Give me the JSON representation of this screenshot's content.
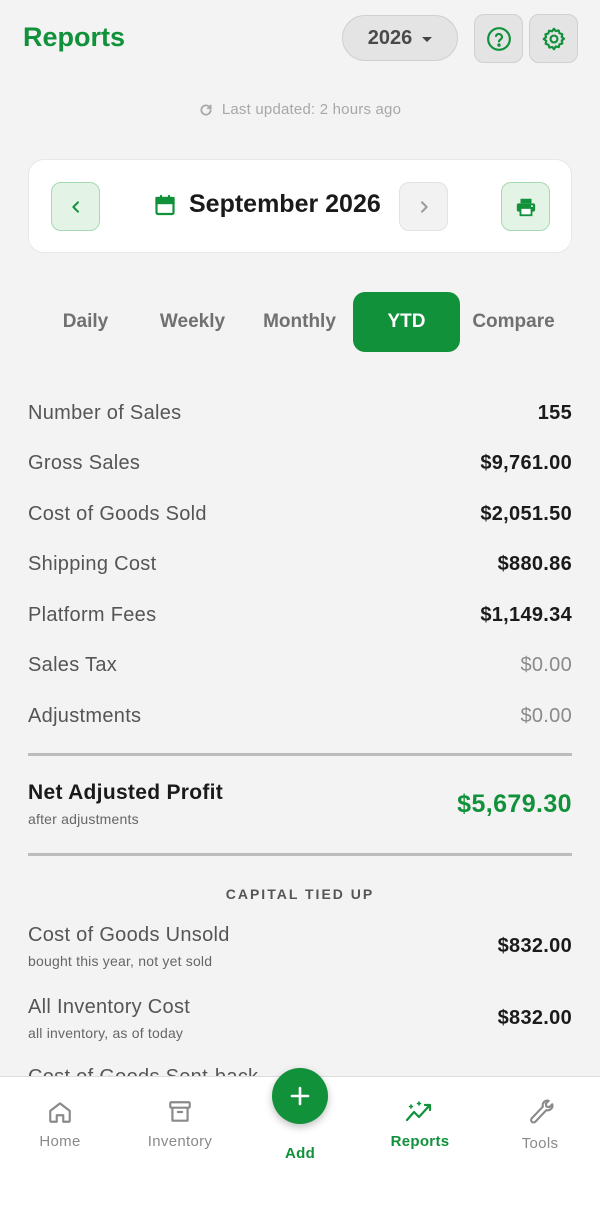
{
  "header": {
    "title": "Reports",
    "year": "2026",
    "help_icon": "help-circle-icon",
    "settings_icon": "gear-icon"
  },
  "last_updated": "Last updated: 2 hours ago",
  "month_nav": {
    "month": "September 2026",
    "prev_icon": "chevron-left-icon",
    "next_icon": "chevron-right-icon",
    "print_icon": "printer-icon",
    "calendar_icon": "calendar-icon"
  },
  "tabs": [
    {
      "label": "Daily",
      "active": false
    },
    {
      "label": "Weekly",
      "active": false
    },
    {
      "label": "Monthly",
      "active": false
    },
    {
      "label": "YTD",
      "active": true
    },
    {
      "label": "Compare",
      "active": false
    }
  ],
  "summary": [
    {
      "label": "Number of Sales",
      "value": "155"
    },
    {
      "label": "Gross Sales",
      "value": "$9,761.00"
    },
    {
      "label": "Cost of Goods Sold",
      "value": "$2,051.50"
    },
    {
      "label": "Shipping Cost",
      "value": "$880.86"
    },
    {
      "label": "Platform Fees",
      "value": "$1,149.34"
    },
    {
      "label": "Sales Tax",
      "value": "$0.00"
    },
    {
      "label": "Adjustments",
      "value": "$0.00"
    }
  ],
  "net_profit": {
    "label": "Net Adjusted Profit",
    "sublabel": "after adjustments",
    "value": "$5,679.30"
  },
  "capital": {
    "title": "CAPITAL TIED UP",
    "items": [
      {
        "label": "Cost of Goods Unsold",
        "sublabel": "bought this year, not yet sold",
        "value": "$832.00"
      },
      {
        "label": "All Inventory Cost",
        "sublabel": "all inventory, as of today",
        "value": "$832.00"
      }
    ],
    "partial_label": "Cost of Goods Sent-back"
  },
  "bottom_nav": [
    {
      "label": "Home",
      "icon": "home-icon",
      "active": false
    },
    {
      "label": "Inventory",
      "icon": "archive-icon",
      "active": false
    },
    {
      "label": "Add",
      "icon": "plus-icon",
      "active": false
    },
    {
      "label": "Reports",
      "icon": "trend-chart-icon",
      "active": true
    },
    {
      "label": "Tools",
      "icon": "wrench-icon",
      "active": false
    }
  ],
  "colors": {
    "accent": "#12913b",
    "background": "#f3f3f3"
  }
}
